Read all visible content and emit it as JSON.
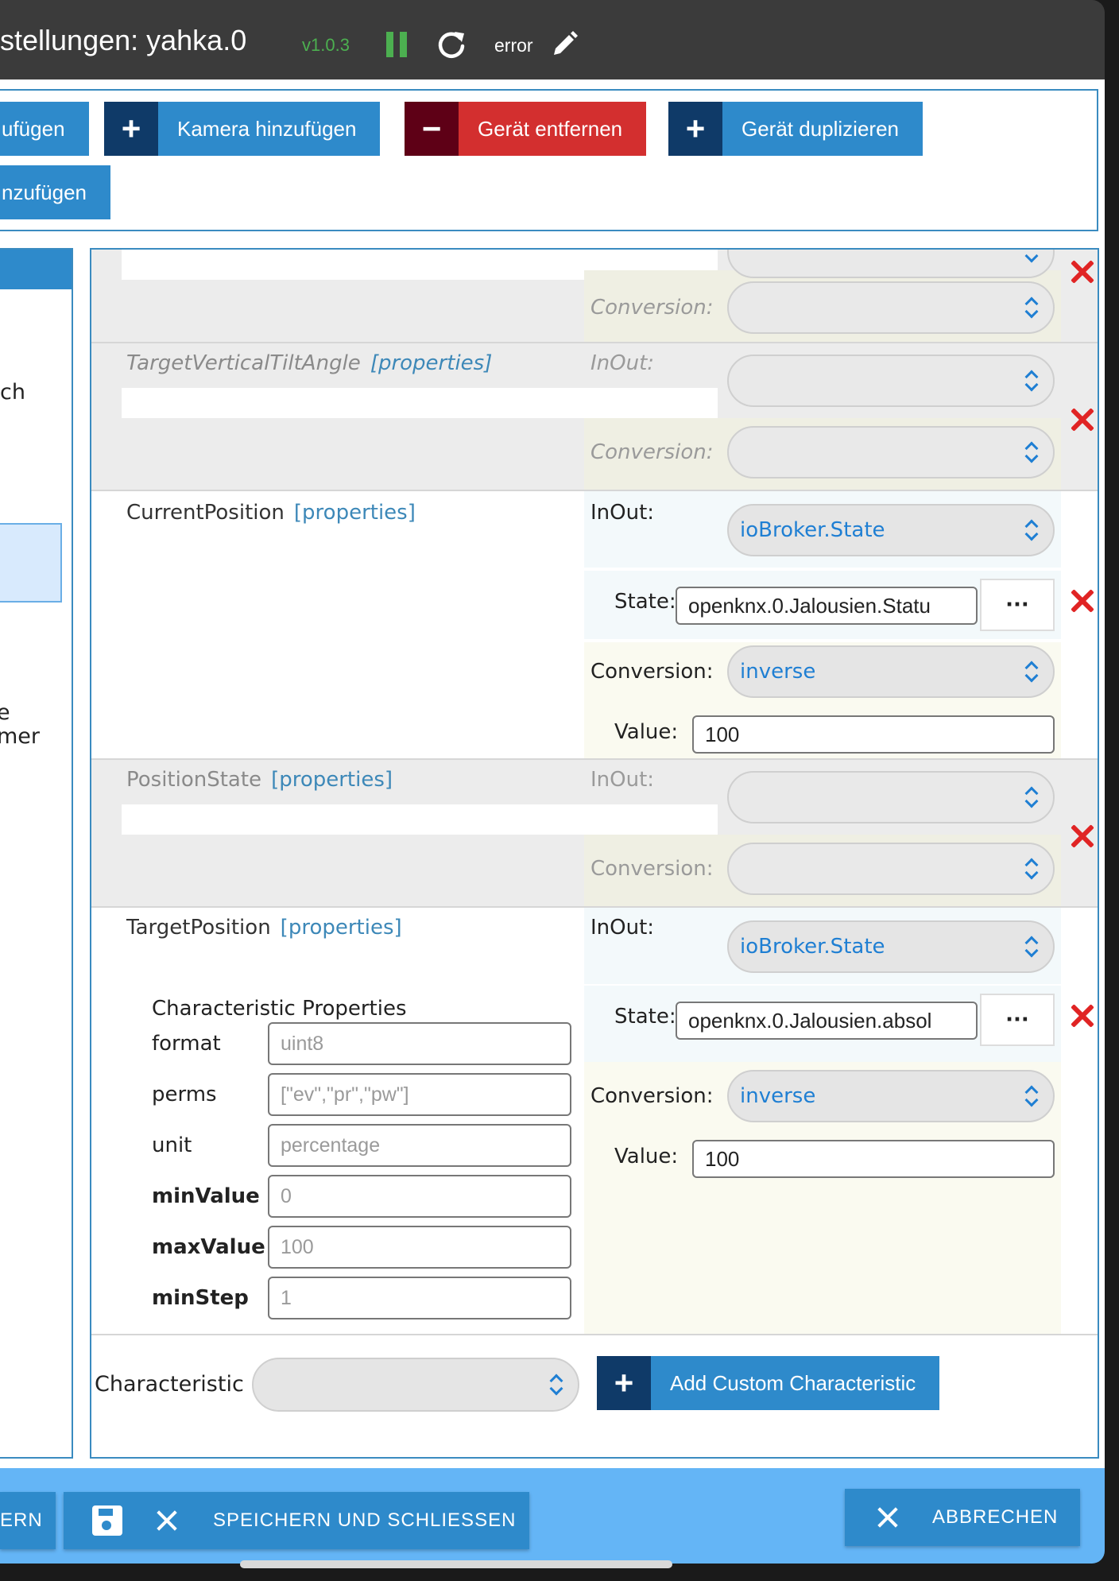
{
  "header": {
    "title": "stellungen: yahka.0",
    "version": "v1.0.3",
    "status": "error"
  },
  "toolbar": {
    "btn_partial1": "ufügen",
    "btn_camera": "Kamera hinzufügen",
    "btn_remove": "Gerät entfernen",
    "btn_duplicate": "Gerät duplizieren",
    "btn_partial2": "nzufügen"
  },
  "left": {
    "text1": "ch",
    "text2_line1": "e",
    "text2_line2": "mer"
  },
  "labels": {
    "properties": "[properties]",
    "inout": "InOut:",
    "conversion": "Conversion:",
    "state": "State:",
    "value": "Value:",
    "dots": "···"
  },
  "characteristics": {
    "target_vertical_tilt": {
      "name": "TargetVerticalTiltAngle"
    },
    "current_position": {
      "name": "CurrentPosition",
      "inout": "ioBroker.State",
      "state": "openknx.0.Jalousien.Statu",
      "conversion": "inverse",
      "value": "100"
    },
    "position_state": {
      "name": "PositionState"
    },
    "target_position": {
      "name": "TargetPosition",
      "inout": "ioBroker.State",
      "state": "openknx.0.Jalousien.absol",
      "conversion": "inverse",
      "value": "100",
      "props_title": "Characteristic Properties",
      "props": [
        {
          "key": "format",
          "value": "uint8"
        },
        {
          "key": "perms",
          "value": "[\"ev\",\"pr\",\"pw\"]"
        },
        {
          "key": "unit",
          "value": "percentage"
        },
        {
          "key": "minValue",
          "value": "0"
        },
        {
          "key": "maxValue",
          "value": "100"
        },
        {
          "key": "minStep",
          "value": "1"
        }
      ]
    }
  },
  "footer_form": {
    "characteristic_label": "Characteristic",
    "add_custom": "Add Custom Characteristic"
  },
  "bottom": {
    "partial": "ERN",
    "save_close": "SPEICHERN UND SCHLIESSEN",
    "cancel": "ABBRECHEN"
  },
  "colors": {
    "accent": "#2e8acb",
    "danger": "#d32f2f",
    "ok": "#4caf50",
    "link": "#1f7fd3"
  }
}
